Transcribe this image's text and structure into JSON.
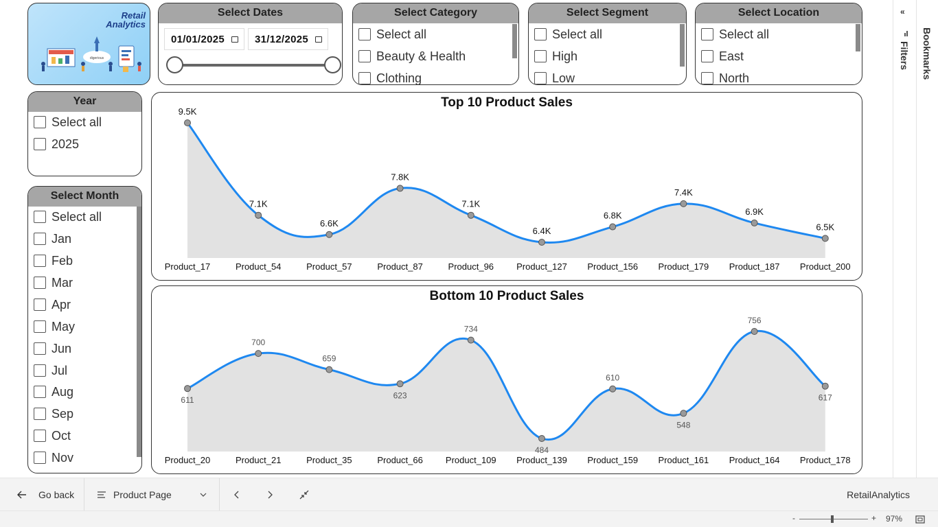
{
  "logo": {
    "line1": "Retail",
    "line2": "Analytics",
    "caption": "digerious"
  },
  "dates": {
    "title": "Select Dates",
    "start": "01/01/2025",
    "end": "31/12/2025"
  },
  "category": {
    "title": "Select Category",
    "options": [
      "Select all",
      "Beauty & Health",
      "Clothing"
    ]
  },
  "segment": {
    "title": "Select Segment",
    "options": [
      "Select all",
      "High",
      "Low"
    ]
  },
  "location": {
    "title": "Select Location",
    "options": [
      "Select all",
      "East",
      "North"
    ]
  },
  "year": {
    "title": "Year",
    "options": [
      "Select all",
      "2025"
    ]
  },
  "month": {
    "title": "Select Month",
    "options": [
      "Select all",
      "Jan",
      "Feb",
      "Mar",
      "Apr",
      "May",
      "Jun",
      "Jul",
      "Aug",
      "Sep",
      "Oct",
      "Nov"
    ]
  },
  "chart_data": [
    {
      "type": "area",
      "title": "Top 10 Product Sales",
      "categories": [
        "Product_17",
        "Product_54",
        "Product_57",
        "Product_87",
        "Product_96",
        "Product_127",
        "Product_156",
        "Product_179",
        "Product_187",
        "Product_200"
      ],
      "values": [
        9500,
        7100,
        6600,
        7800,
        7100,
        6400,
        6800,
        7400,
        6900,
        6500
      ],
      "labels": [
        "9.5K",
        "7.1K",
        "6.6K",
        "7.8K",
        "7.1K",
        "6.4K",
        "6.8K",
        "7.4K",
        "6.9K",
        "6.5K"
      ],
      "line_color": "#1e88f0",
      "fill_color": "#e2e2e2"
    },
    {
      "type": "area",
      "title": "Bottom 10 Product Sales",
      "categories": [
        "Product_20",
        "Product_21",
        "Product_35",
        "Product_66",
        "Product_109",
        "Product_139",
        "Product_159",
        "Product_161",
        "Product_164",
        "Product_178"
      ],
      "values": [
        611,
        700,
        659,
        623,
        734,
        484,
        610,
        548,
        756,
        617
      ],
      "labels": [
        "611",
        "700",
        "659",
        "623",
        "734",
        "484",
        "610",
        "548",
        "756",
        "617"
      ],
      "line_color": "#1e88f0",
      "fill_color": "#e2e2e2"
    }
  ],
  "panes": {
    "filters": "Filters",
    "bookmarks": "Bookmarks"
  },
  "bottom_bar": {
    "go_back": "Go back",
    "page": "Product Page",
    "report_name": "RetailAnalytics"
  },
  "status_bar": {
    "zoom_minus": "-",
    "zoom_plus": "+",
    "zoom": "97%"
  }
}
